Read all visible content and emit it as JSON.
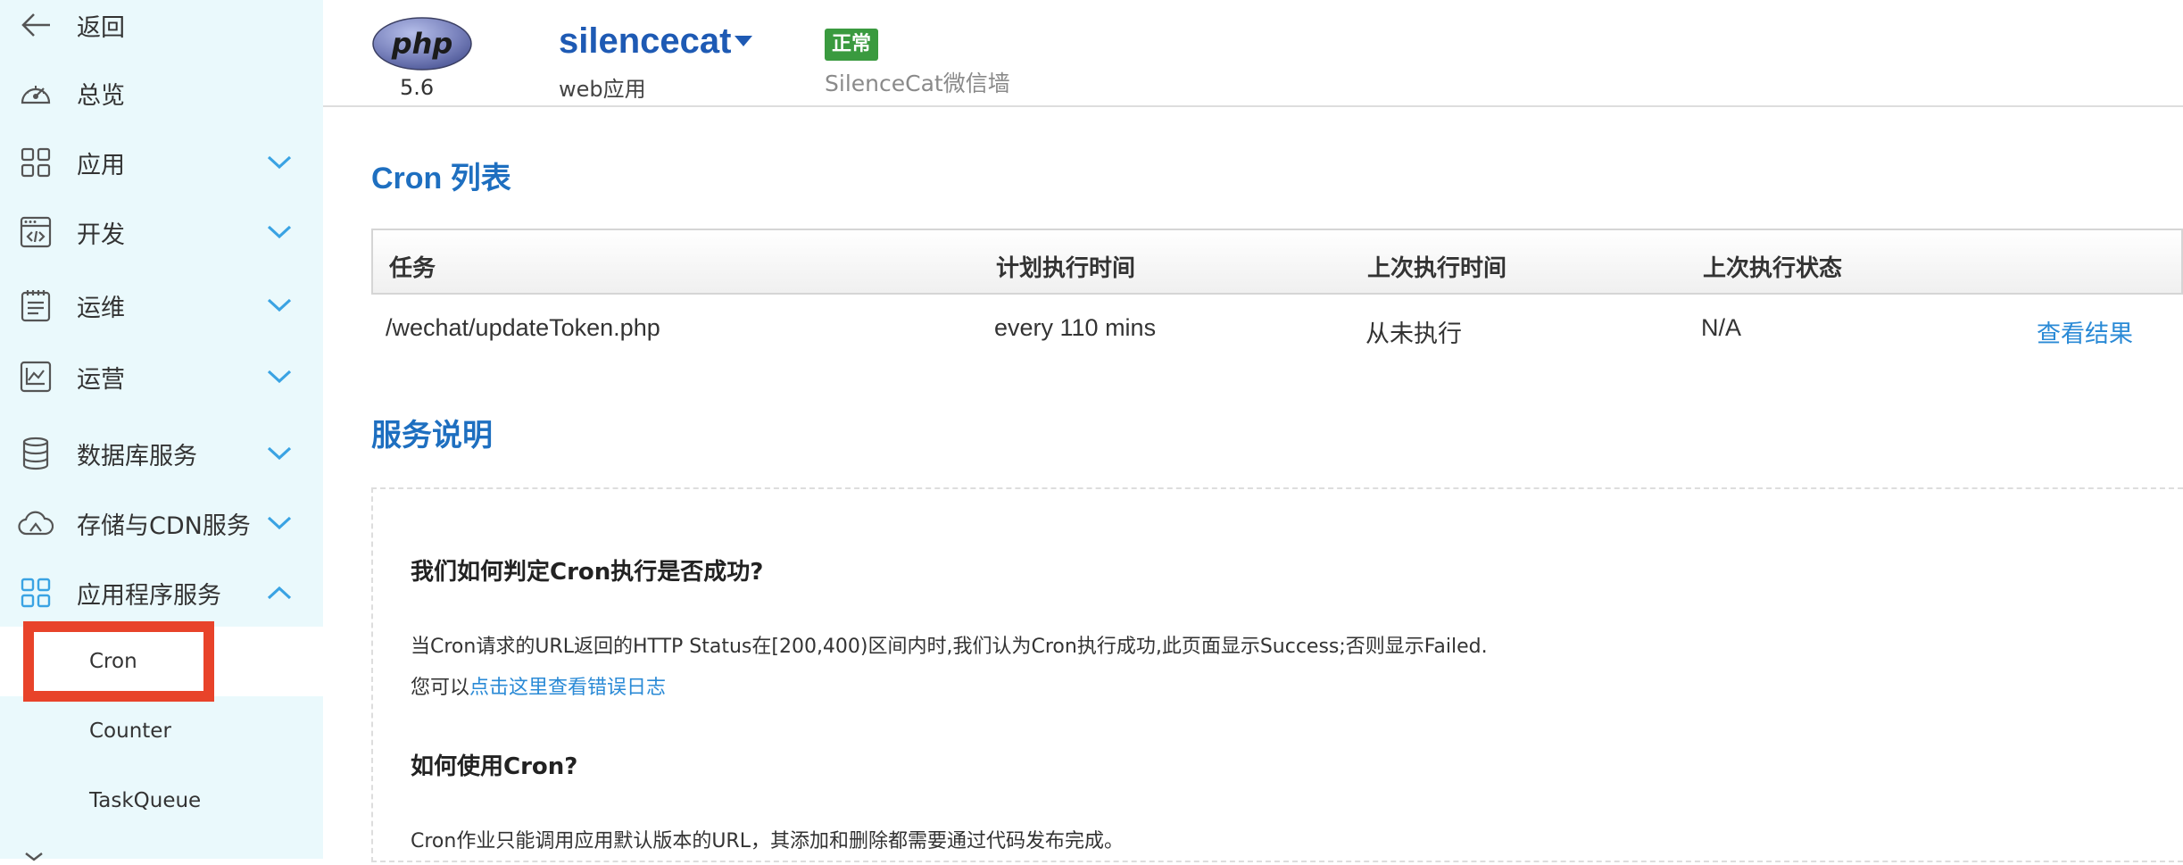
{
  "sidebar": {
    "back": {
      "label": "返回",
      "icon": "arrow-left-icon"
    },
    "items": [
      {
        "label": "总览",
        "icon": "dashboard-gauge-icon",
        "expandable": false
      },
      {
        "label": "应用",
        "icon": "grid-icon",
        "expandable": true,
        "expanded": false
      },
      {
        "label": "开发",
        "icon": "code-window-icon",
        "expandable": true,
        "expanded": false
      },
      {
        "label": "运维",
        "icon": "clipboard-icon",
        "expandable": true,
        "expanded": false
      },
      {
        "label": "运营",
        "icon": "chart-window-icon",
        "expandable": true,
        "expanded": false
      },
      {
        "label": "数据库服务",
        "icon": "database-icon",
        "expandable": true,
        "expanded": false
      },
      {
        "label": "存储与CDN服务",
        "icon": "cloud-icon",
        "expandable": true,
        "expanded": false
      },
      {
        "label": "应用程序服务",
        "icon": "grid-icon",
        "expandable": true,
        "expanded": true
      }
    ],
    "subitems": [
      {
        "label": "Cron",
        "active": true
      },
      {
        "label": "Counter",
        "active": false
      },
      {
        "label": "TaskQueue",
        "active": false
      }
    ]
  },
  "header": {
    "logo_text": "php",
    "php_version": "5.6",
    "app_name": "silencecat",
    "app_type": "web应用",
    "status": "正常",
    "app_description": "SilenceCat微信墙"
  },
  "cron": {
    "title": "Cron 列表",
    "columns": [
      "任务",
      "计划执行时间",
      "上次执行时间",
      "上次执行状态"
    ],
    "rows": [
      {
        "task": "/wechat/updateToken.php",
        "schedule": "every 110 mins",
        "last_run": "从未执行",
        "last_status": "N/A",
        "action": "查看结果"
      }
    ]
  },
  "service": {
    "title": "服务说明",
    "q1": "我们如何判定Cron执行是否成功?",
    "p1": "当Cron请求的URL返回的HTTP Status在[200,400)区间内时,我们认为Cron执行成功,此页面显示Success;否则显示Failed.",
    "p2_prefix": "您可以",
    "p2_link": "点击这里查看错误日志",
    "q2": "如何使用Cron?",
    "p3": "Cron作业只能调用应用默认版本的URL，其添加和删除都需要通过代码发布完成。"
  },
  "colors": {
    "sidebar_bg": "#eaf9fc",
    "accent_blue": "#1e6fc0",
    "link_blue": "#2a8ad6",
    "status_green": "#3a9a3f",
    "highlight_red": "#e8432a",
    "chevron_blue": "#3aa3e3"
  }
}
